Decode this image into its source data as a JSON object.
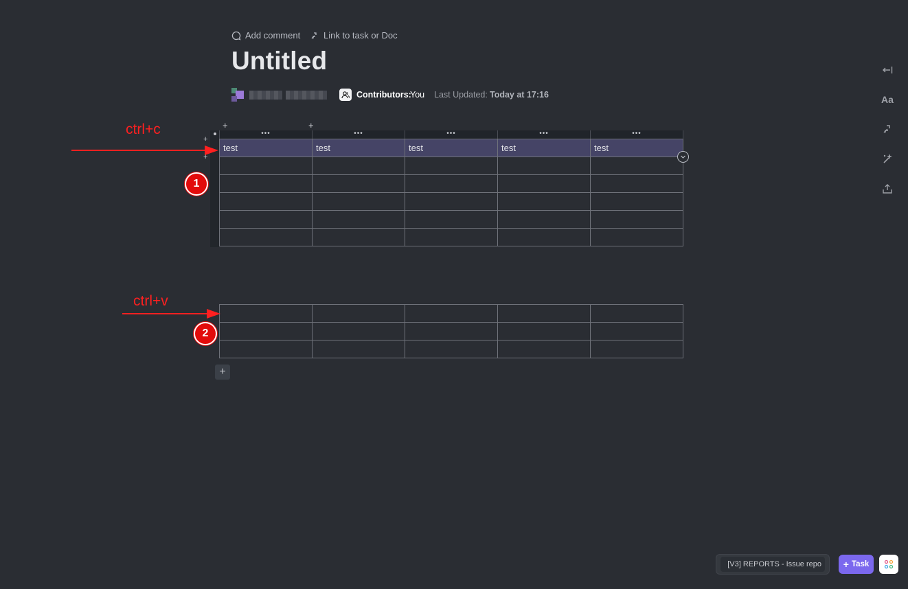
{
  "header": {
    "add_comment": "Add comment",
    "link_task": "Link to task or Doc"
  },
  "doc": {
    "title": "Untitled",
    "contributors_label": "Contributors:",
    "contributors_value": "You",
    "last_updated_label": "Last Updated:",
    "last_updated_value": "Today at 17:16"
  },
  "table1": {
    "col_handle": "•••",
    "rows": [
      [
        "test",
        "test",
        "test",
        "test",
        "test"
      ],
      [
        "",
        "",
        "",
        "",
        ""
      ],
      [
        "",
        "",
        "",
        "",
        ""
      ],
      [
        "",
        "",
        "",
        "",
        ""
      ],
      [
        "",
        "",
        "",
        "",
        ""
      ],
      [
        "",
        "",
        "",
        "",
        ""
      ]
    ]
  },
  "table2": {
    "rows": [
      [
        "",
        "",
        "",
        "",
        ""
      ],
      [
        "",
        "",
        "",
        "",
        ""
      ],
      [
        "",
        "",
        "",
        "",
        ""
      ]
    ]
  },
  "annotations": {
    "copy_label": "ctrl+c",
    "paste_label": "ctrl+v",
    "badge1": "1",
    "badge2": "2",
    "color": "#ff2020"
  },
  "right_rail": {
    "icons": [
      "collapse-icon",
      "font-icon",
      "link-icon",
      "ai-sparkle-icon",
      "share-icon"
    ],
    "font_label": "Aa"
  },
  "bottom_bar": {
    "doc_tab": "[V3] REPORTS - Issue repo",
    "task_label": "Task",
    "accent": "#7b68ee"
  }
}
